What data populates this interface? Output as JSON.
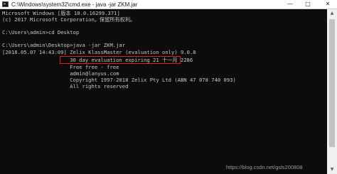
{
  "window": {
    "title": "C:\\Windows\\system32\\cmd.exe - java -jar ZKM.jar",
    "icon": "cmd-icon",
    "controls": {
      "minimize": "—",
      "maximize": "□",
      "close": "✕"
    }
  },
  "console": {
    "lines": [
      "Microsoft Windows [版本 10.0.16299.371]",
      "(c) 2017 Microsoft Corporation。保留所有权利。",
      "",
      "C:\\Users\\admin>cd Desktop",
      "",
      "C:\\Users\\admin\\Desktop>java -jar ZKM.jar",
      "[2018.05.07 14:43:09] Zelix KlassMaster (evaluation only) 9.0.8",
      "                      30 day evaluation expiring 21 十一月 2286",
      "                      Free free - free",
      "                      admin@lanyus.com",
      "                      Copyright 1997-2018 Zelix Pty Ltd (ABN 47 078 740 093)",
      "                      All rights reserved"
    ]
  },
  "watermark": "https://blog.csdn.net/gsls200808",
  "colors": {
    "background": "#0c0c0c",
    "text": "#c8c8c8",
    "highlight_border": "#e02020"
  }
}
